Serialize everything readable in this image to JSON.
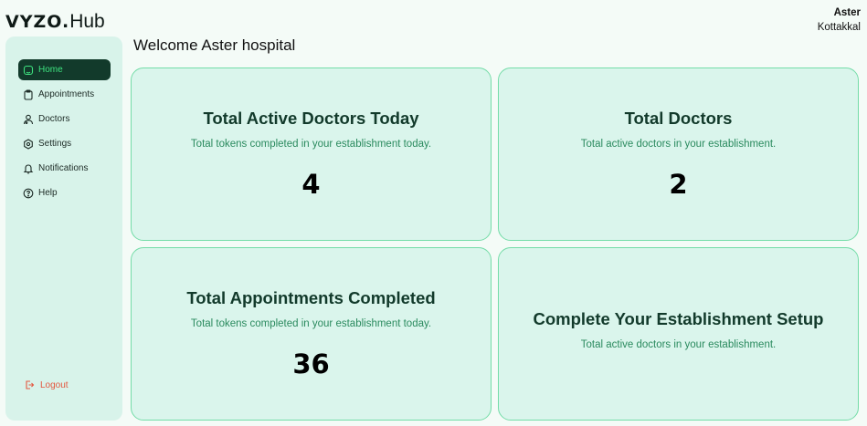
{
  "brand": {
    "part1": "VYZO.",
    "part2": "Hub"
  },
  "user": {
    "name": "Aster",
    "location": "Kottakkal"
  },
  "welcome": "Welcome Aster hospital",
  "sidebar": {
    "items": [
      {
        "label": "Home",
        "icon": "home-icon",
        "active": true
      },
      {
        "label": "Appointments",
        "icon": "clipboard-icon",
        "active": false
      },
      {
        "label": "Doctors",
        "icon": "doctor-icon",
        "active": false
      },
      {
        "label": "Settings",
        "icon": "gear-icon",
        "active": false
      },
      {
        "label": "Notifications",
        "icon": "bell-icon",
        "active": false
      },
      {
        "label": "Help",
        "icon": "help-icon",
        "active": false
      }
    ],
    "logout": "Logout"
  },
  "cards": [
    {
      "title": "Total Active Doctors Today",
      "subtitle": "Total tokens completed in your establishment today.",
      "value": "4"
    },
    {
      "title": "Total Doctors",
      "subtitle": "Total active doctors in your establishment.",
      "value": "2"
    },
    {
      "title": "Total Appointments Completed",
      "subtitle": "Total tokens completed in your establishment today.",
      "value": "36"
    },
    {
      "title": "Complete Your Establishment Setup",
      "subtitle": "Total active doctors in your establishment."
    }
  ],
  "colors": {
    "accent": "#3ee27f",
    "active_bg": "#123a2b",
    "card_bg": "#daf5ec",
    "card_border": "#74dca8",
    "sidebar_bg": "#d8f3ea",
    "logout": "#e4573f"
  }
}
